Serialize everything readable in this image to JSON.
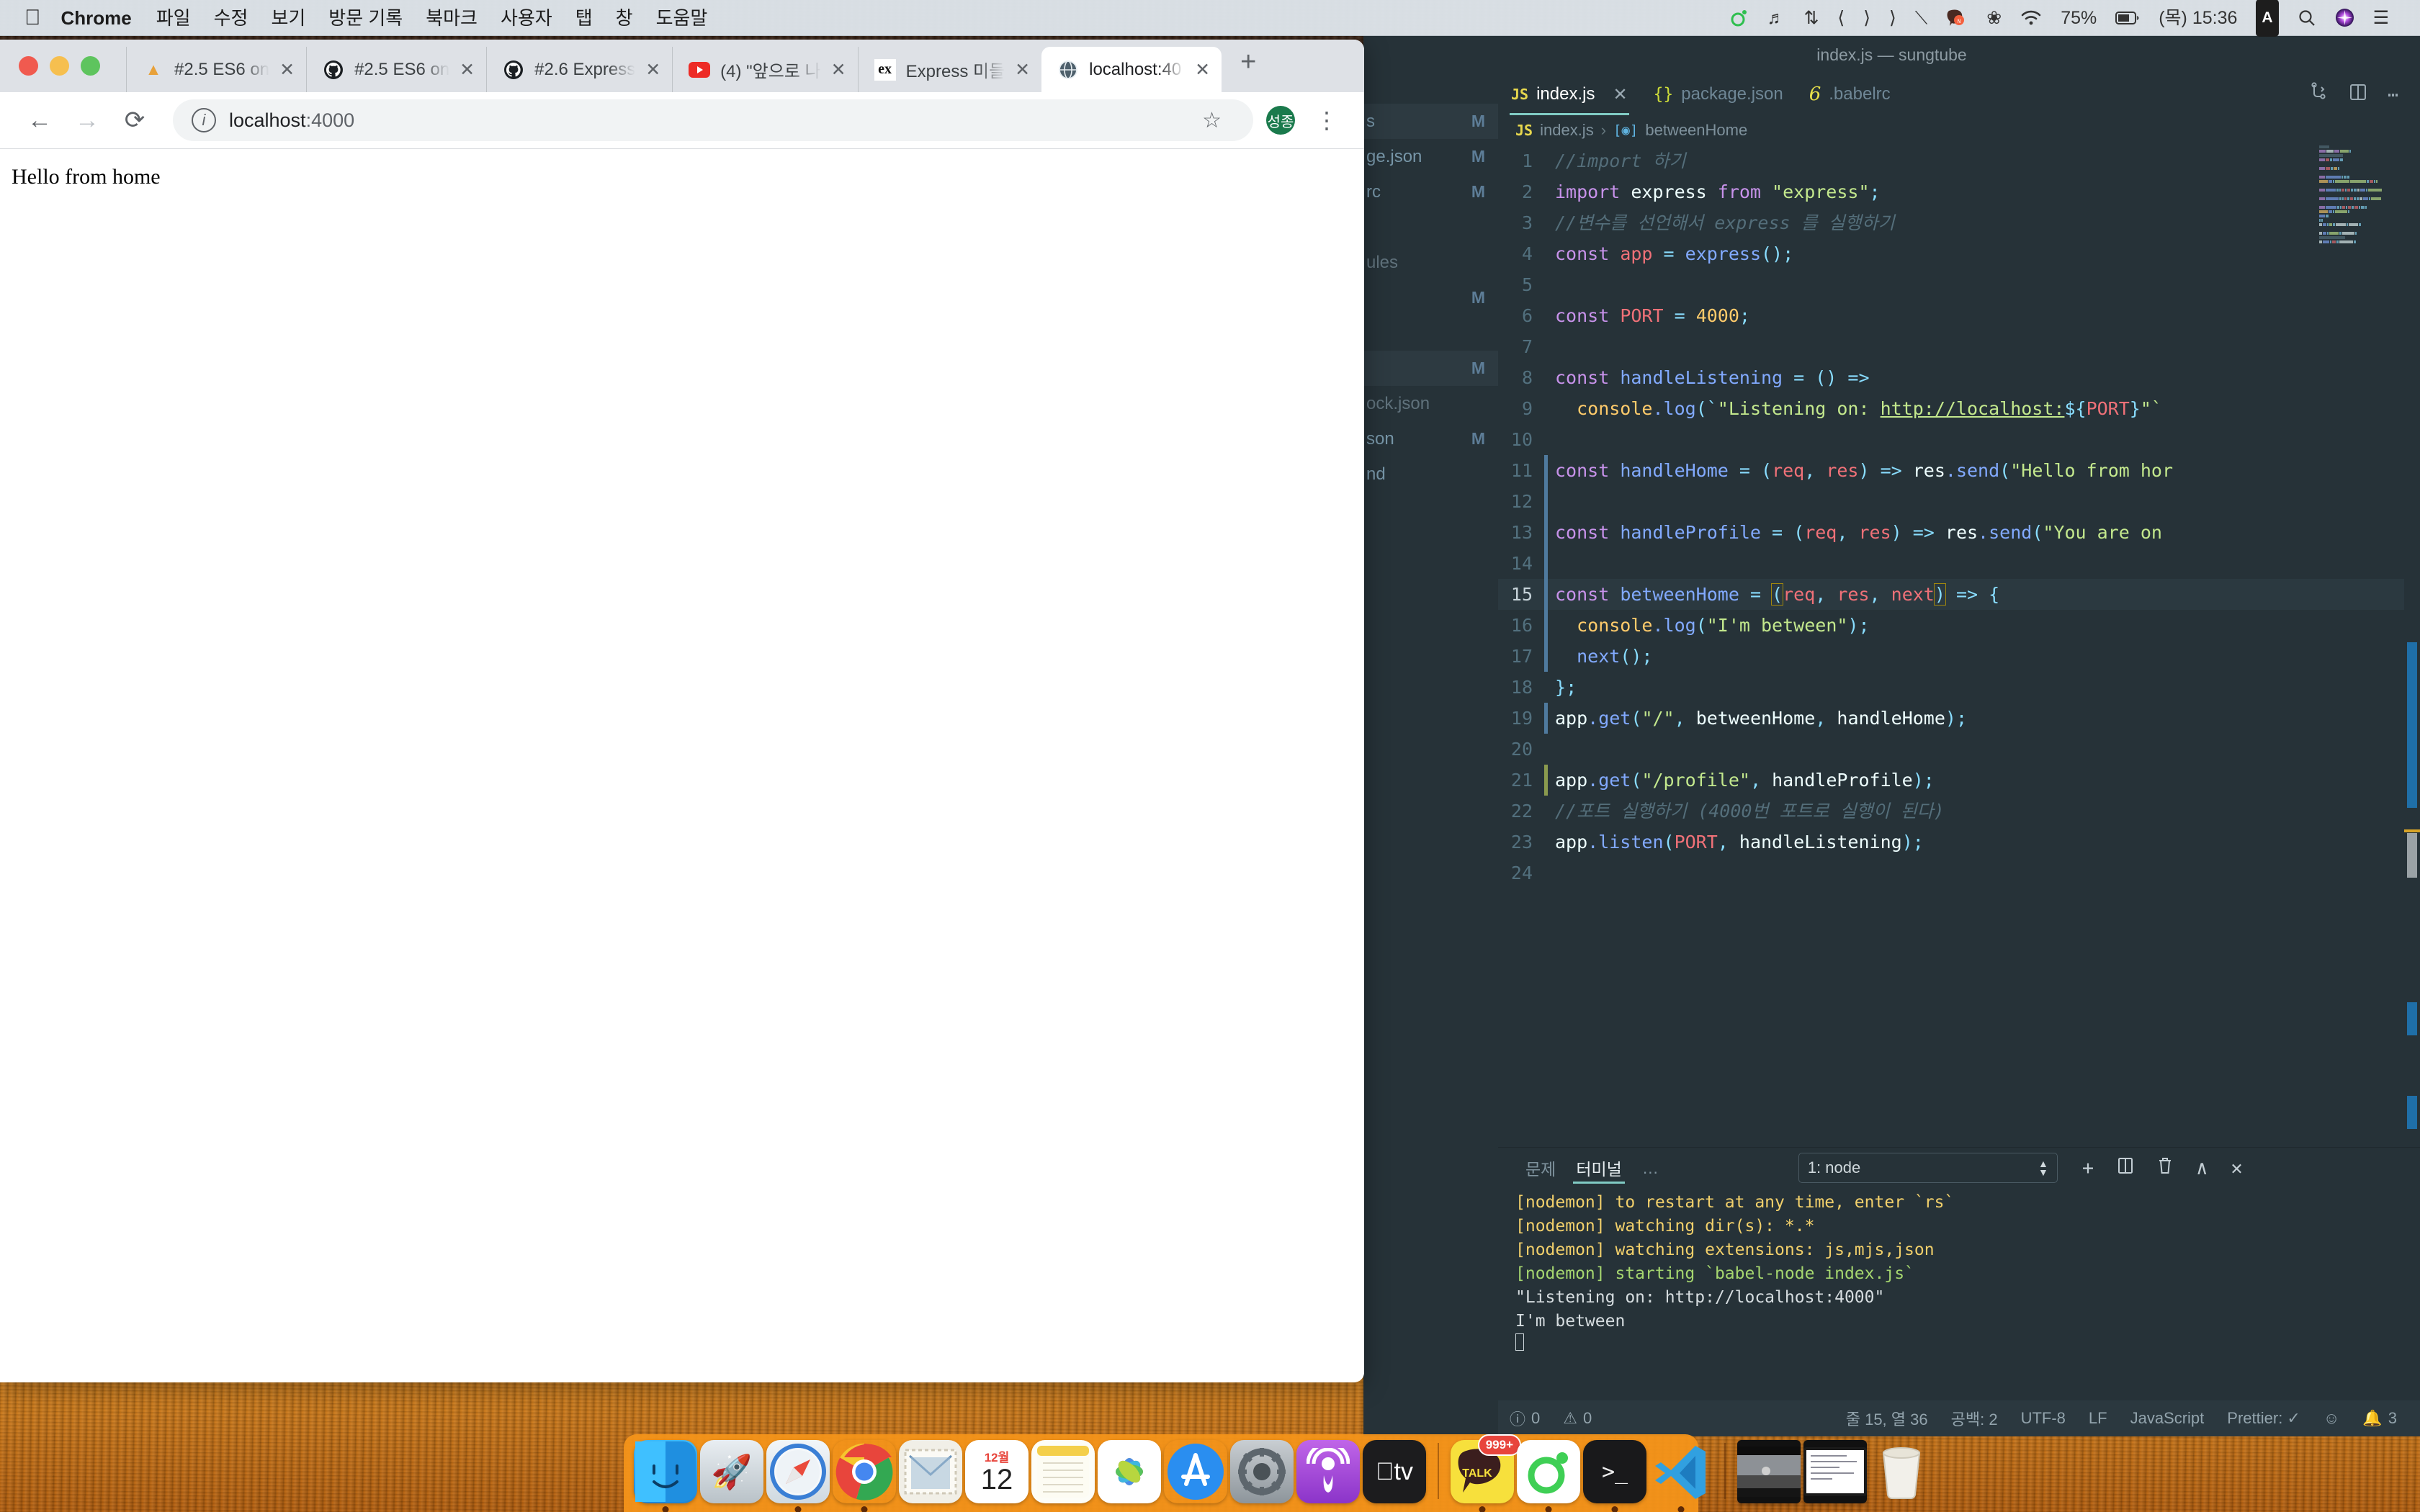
{
  "menubar": {
    "apple_icon": "apple-logo",
    "app_name": "Chrome",
    "items": [
      "파일",
      "수정",
      "보기",
      "방문 기록",
      "북마크",
      "사용자",
      "탭",
      "창",
      "도움말"
    ],
    "right": {
      "battery_percent": "75%",
      "clock": "(목) 15:36",
      "input_source": "A",
      "icons": [
        "chrome-remote-icon",
        "music-note-icon",
        "repeat-icon",
        "previous-track-icon",
        "play-icon",
        "next-track-icon",
        "shuffle-icon",
        "kakao-icon",
        "bluetooth-icon",
        "wifi-icon",
        "battery-icon",
        "spotlight-search-icon",
        "siri-icon",
        "control-center-icon"
      ]
    }
  },
  "chrome": {
    "tabs": [
      {
        "favicon": "warning-triangle-icon",
        "title": "#2.5 ES6 on",
        "active": false
      },
      {
        "favicon": "github-icon",
        "title": "#2.5 ES6 on",
        "active": false
      },
      {
        "favicon": "github-icon",
        "title": "#2.6 Express",
        "active": false
      },
      {
        "favicon": "youtube-icon",
        "title": "(4) \"앞으로 나",
        "active": false
      },
      {
        "favicon": "express-icon",
        "title": "Express 미들",
        "active": false
      },
      {
        "favicon": "globe-icon",
        "title": "localhost:40",
        "active": true
      }
    ],
    "new_tab_label": "+",
    "toolbar": {
      "back": "←",
      "forward": "→",
      "reload": "⟳",
      "url_host": "localhost",
      "url_port": ":4000",
      "star": "☆",
      "avatar_initial": "성종",
      "menu": "⋮"
    },
    "page": {
      "body_text": "Hello from home"
    }
  },
  "vscode": {
    "window_title": "index.js — sungtube",
    "sidebar_rows": [
      {
        "name": "s",
        "status": "M",
        "selected": true
      },
      {
        "name": "ge.json",
        "status": "M",
        "selected": false
      },
      {
        "name": "rc",
        "status": "M",
        "selected": false
      },
      {
        "name": "",
        "status": "",
        "selected": false
      },
      {
        "name": "ules",
        "status": "",
        "selected": false,
        "dim": true
      },
      {
        "name": "",
        "status": "M",
        "selected": false
      },
      {
        "name": "",
        "status": "",
        "selected": false
      },
      {
        "name": "",
        "status": "M",
        "selected": true
      },
      {
        "name": "ock.json",
        "status": "",
        "selected": false,
        "dim": true
      },
      {
        "name": "son",
        "status": "M",
        "selected": false
      },
      {
        "name": "nd",
        "status": "",
        "selected": false
      }
    ],
    "tabs": [
      {
        "icon": "js-file-icon",
        "label": "index.js",
        "active": true,
        "closable": true
      },
      {
        "icon": "json-file-icon",
        "label": "package.json",
        "active": false,
        "closable": false
      },
      {
        "icon": "babel-file-icon",
        "label": ".babelrc",
        "active": false,
        "closable": false
      }
    ],
    "tab_actions": [
      "split-compare-icon",
      "split-editor-icon",
      "more-actions-icon"
    ],
    "breadcrumb": {
      "file_icon": "js-file-icon",
      "file": "index.js",
      "separator": "›",
      "symbol_icon": "function-symbol-icon",
      "symbol": "betweenHome"
    },
    "code_lines": [
      {
        "n": "1",
        "change": "",
        "tokens": [
          {
            "t": "//import 하기",
            "c": "com"
          }
        ]
      },
      {
        "n": "2",
        "change": "",
        "tokens": [
          {
            "t": "import ",
            "c": "k"
          },
          {
            "t": "express ",
            "c": "pl"
          },
          {
            "t": "from ",
            "c": "k"
          },
          {
            "t": "\"express\"",
            "c": "str"
          },
          {
            "t": ";",
            "c": "op"
          }
        ]
      },
      {
        "n": "3",
        "change": "",
        "tokens": [
          {
            "t": "//변수를 선언해서 express 를 실행하기",
            "c": "com"
          }
        ]
      },
      {
        "n": "4",
        "change": "",
        "tokens": [
          {
            "t": "const ",
            "c": "k"
          },
          {
            "t": "app ",
            "c": "var"
          },
          {
            "t": "= ",
            "c": "op"
          },
          {
            "t": "express",
            "c": "fn"
          },
          {
            "t": "();",
            "c": "op"
          }
        ]
      },
      {
        "n": "5",
        "change": "",
        "tokens": []
      },
      {
        "n": "6",
        "change": "",
        "tokens": [
          {
            "t": "const ",
            "c": "k"
          },
          {
            "t": "PORT ",
            "c": "var"
          },
          {
            "t": "= ",
            "c": "op"
          },
          {
            "t": "4000",
            "c": "met"
          },
          {
            "t": ";",
            "c": "op"
          }
        ]
      },
      {
        "n": "7",
        "change": "",
        "tokens": []
      },
      {
        "n": "8",
        "change": "",
        "tokens": [
          {
            "t": "const ",
            "c": "k"
          },
          {
            "t": "handleListening ",
            "c": "fn"
          },
          {
            "t": "= ",
            "c": "op"
          },
          {
            "t": "() ",
            "c": "op"
          },
          {
            "t": "=>",
            "c": "op"
          }
        ]
      },
      {
        "n": "9",
        "change": "",
        "tokens": [
          {
            "t": "  console",
            "c": "met"
          },
          {
            "t": ".log",
            "c": "fn"
          },
          {
            "t": "(`",
            "c": "op"
          },
          {
            "t": "\"Listening on: ",
            "c": "str"
          },
          {
            "t": "http://localhost:",
            "c": "strlnk"
          },
          {
            "t": "${",
            "c": "op"
          },
          {
            "t": "PORT",
            "c": "var"
          },
          {
            "t": "}",
            "c": "op"
          },
          {
            "t": "\"`",
            "c": "str"
          }
        ]
      },
      {
        "n": "10",
        "change": "",
        "tokens": []
      },
      {
        "n": "11",
        "change": "blue",
        "tokens": [
          {
            "t": "const ",
            "c": "k"
          },
          {
            "t": "handleHome ",
            "c": "fn"
          },
          {
            "t": "= ",
            "c": "op"
          },
          {
            "t": "(",
            "c": "op"
          },
          {
            "t": "req",
            "c": "var"
          },
          {
            "t": ", ",
            "c": "op"
          },
          {
            "t": "res",
            "c": "var"
          },
          {
            "t": ") ",
            "c": "op"
          },
          {
            "t": "=> ",
            "c": "op"
          },
          {
            "t": "res",
            "c": "pl"
          },
          {
            "t": ".send",
            "c": "fn"
          },
          {
            "t": "(",
            "c": "op"
          },
          {
            "t": "\"Hello from hor",
            "c": "str"
          }
        ]
      },
      {
        "n": "12",
        "change": "blue",
        "tokens": []
      },
      {
        "n": "13",
        "change": "blue",
        "tokens": [
          {
            "t": "const ",
            "c": "k"
          },
          {
            "t": "handleProfile ",
            "c": "fn"
          },
          {
            "t": "= ",
            "c": "op"
          },
          {
            "t": "(",
            "c": "op"
          },
          {
            "t": "req",
            "c": "var"
          },
          {
            "t": ", ",
            "c": "op"
          },
          {
            "t": "res",
            "c": "var"
          },
          {
            "t": ") ",
            "c": "op"
          },
          {
            "t": "=> ",
            "c": "op"
          },
          {
            "t": "res",
            "c": "pl"
          },
          {
            "t": ".send",
            "c": "fn"
          },
          {
            "t": "(",
            "c": "op"
          },
          {
            "t": "\"You are on",
            "c": "str"
          }
        ]
      },
      {
        "n": "14",
        "change": "blue",
        "tokens": []
      },
      {
        "n": "15",
        "change": "blue",
        "highlight": true,
        "tokens": [
          {
            "t": "const ",
            "c": "k"
          },
          {
            "t": "betweenHome ",
            "c": "fn"
          },
          {
            "t": "= ",
            "c": "op"
          },
          {
            "t": "(",
            "c": "op boxsel"
          },
          {
            "t": "req",
            "c": "var"
          },
          {
            "t": ", ",
            "c": "op"
          },
          {
            "t": "res",
            "c": "var"
          },
          {
            "t": ", ",
            "c": "op"
          },
          {
            "t": "next",
            "c": "var"
          },
          {
            "t": ")",
            "c": "op boxsel"
          },
          {
            "t": " => ",
            "c": "op"
          },
          {
            "t": "{",
            "c": "op"
          }
        ]
      },
      {
        "n": "16",
        "change": "blue",
        "tokens": [
          {
            "t": "  console",
            "c": "met"
          },
          {
            "t": ".log",
            "c": "fn"
          },
          {
            "t": "(",
            "c": "op"
          },
          {
            "t": "\"I'm between\"",
            "c": "str"
          },
          {
            "t": ");",
            "c": "op"
          }
        ]
      },
      {
        "n": "17",
        "change": "blue",
        "tokens": [
          {
            "t": "  next",
            "c": "fn"
          },
          {
            "t": "();",
            "c": "op"
          }
        ]
      },
      {
        "n": "18",
        "change": "",
        "tokens": [
          {
            "t": "}",
            "c": "op"
          },
          {
            "t": ";",
            "c": "op"
          }
        ]
      },
      {
        "n": "19",
        "change": "blue",
        "tokens": [
          {
            "t": "app",
            "c": "pl"
          },
          {
            "t": ".get",
            "c": "fn"
          },
          {
            "t": "(",
            "c": "op"
          },
          {
            "t": "\"/\"",
            "c": "str"
          },
          {
            "t": ", ",
            "c": "op"
          },
          {
            "t": "betweenHome",
            "c": "pl"
          },
          {
            "t": ", ",
            "c": "op"
          },
          {
            "t": "handleHome",
            "c": "pl"
          },
          {
            "t": ");",
            "c": "op"
          }
        ]
      },
      {
        "n": "20",
        "change": "",
        "tokens": []
      },
      {
        "n": "21",
        "change": "green",
        "tokens": [
          {
            "t": "app",
            "c": "pl"
          },
          {
            "t": ".get",
            "c": "fn"
          },
          {
            "t": "(",
            "c": "op"
          },
          {
            "t": "\"/profile\"",
            "c": "str"
          },
          {
            "t": ", ",
            "c": "op"
          },
          {
            "t": "handleProfile",
            "c": "pl"
          },
          {
            "t": ");",
            "c": "op"
          }
        ]
      },
      {
        "n": "22",
        "change": "",
        "tokens": [
          {
            "t": "//포트 실행하기 (4000번 포트로 실행이 된다)",
            "c": "com"
          }
        ]
      },
      {
        "n": "23",
        "change": "",
        "tokens": [
          {
            "t": "app",
            "c": "pl"
          },
          {
            "t": ".listen",
            "c": "fn"
          },
          {
            "t": "(",
            "c": "op"
          },
          {
            "t": "PORT",
            "c": "var"
          },
          {
            "t": ", ",
            "c": "op"
          },
          {
            "t": "handleListening",
            "c": "pl"
          },
          {
            "t": ");",
            "c": "op"
          }
        ]
      },
      {
        "n": "24",
        "change": "",
        "tokens": []
      }
    ],
    "panel": {
      "tabs": [
        {
          "label": "문제",
          "active": false
        },
        {
          "label": "터미널",
          "active": true
        }
      ],
      "more": "…",
      "terminal_select": "1: node",
      "actions": [
        "new-terminal-icon",
        "split-terminal-icon",
        "kill-terminal-icon",
        "maximize-panel-icon",
        "close-panel-icon"
      ],
      "terminal_output": [
        {
          "text": "[nodemon] to restart at any time, enter `rs`",
          "color": "yellow"
        },
        {
          "text": "[nodemon] watching dir(s): *.*",
          "color": "yellow"
        },
        {
          "text": "[nodemon] watching extensions: js,mjs,json",
          "color": "yellow"
        },
        {
          "text": "[nodemon] starting `babel-node index.js`",
          "color": "green"
        },
        {
          "text": "\"Listening on: http://localhost:4000\"",
          "color": "white"
        },
        {
          "text": "I'm between",
          "color": "white"
        }
      ]
    },
    "status_bar": {
      "errors": "0",
      "warnings": "0",
      "cursor": "줄 15, 열 36",
      "indent": "공백: 2",
      "encoding": "UTF-8",
      "eol": "LF",
      "language": "JavaScript",
      "formatter": "Prettier: ✓",
      "feedback_icon": "smiley-icon",
      "notifications": "3"
    }
  },
  "dock": {
    "items": [
      {
        "name": "finder",
        "glyph": "🙂",
        "running": true
      },
      {
        "name": "launchpad",
        "glyph": "🚀",
        "running": false
      },
      {
        "name": "safari",
        "glyph": "🧭",
        "running": true
      },
      {
        "name": "chrome",
        "glyph": "◉",
        "running": true
      },
      {
        "name": "mail",
        "glyph": "✉",
        "running": false
      },
      {
        "name": "calendar",
        "glyph": "12",
        "running": false
      },
      {
        "name": "notes",
        "glyph": "▤",
        "running": false
      },
      {
        "name": "photos",
        "glyph": "❀",
        "running": false
      },
      {
        "name": "app-store",
        "glyph": "A",
        "running": false
      },
      {
        "name": "system-preferences",
        "glyph": "⚙",
        "running": false
      },
      {
        "name": "podcasts",
        "glyph": "◎",
        "running": false
      },
      {
        "name": "apple-tv",
        "glyph": "tv",
        "running": false
      },
      {
        "name": "kakaotalk",
        "glyph": "TALK",
        "running": true,
        "badge": "999+"
      },
      {
        "name": "line",
        "glyph": "◯",
        "running": true
      },
      {
        "name": "terminal",
        "glyph": ">_",
        "running": true
      },
      {
        "name": "visual-studio-code",
        "glyph": "✕",
        "running": true
      },
      {
        "name": "keynote-doc",
        "glyph": "▬",
        "running": false
      },
      {
        "name": "text-doc",
        "glyph": "▭",
        "running": false
      },
      {
        "name": "trash",
        "glyph": "🗑",
        "running": false
      }
    ]
  }
}
